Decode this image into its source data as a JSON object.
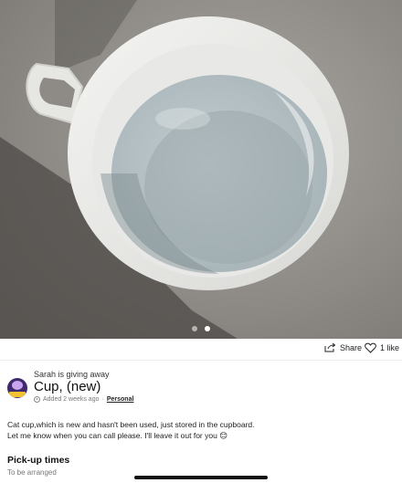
{
  "photo": {
    "description_icon": "cup-photo",
    "carousel_total": 2,
    "carousel_active_index": 2
  },
  "actions": {
    "share_label": "Share",
    "like_label": "1 like"
  },
  "listing": {
    "giver_text": "Sarah is giving away",
    "title": "Cup, (new)",
    "added_text": "Added 2 weeks ago",
    "separator": "·",
    "category": "Personal",
    "description_line1": "Cat cup,which is new and hasn't been used, just stored in the cupboard.",
    "description_line2": "Let me know when you can call please. I'll leave it out for you",
    "description_emoji": "😊"
  },
  "pickup": {
    "heading": "Pick-up times",
    "value": "To be arranged"
  },
  "colors": {
    "accent": "#f2c232",
    "avatar_bg": "#3e2a6b"
  }
}
